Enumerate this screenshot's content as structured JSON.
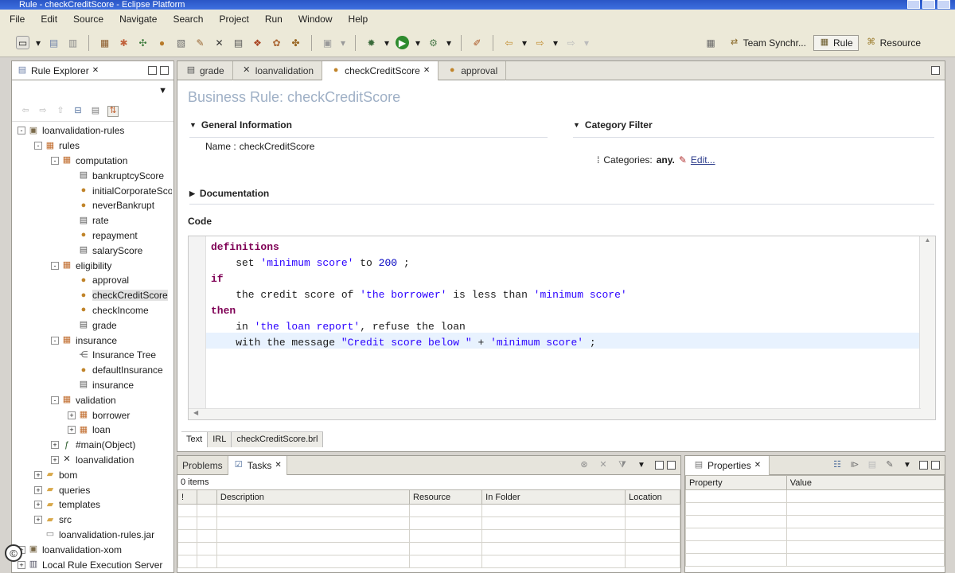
{
  "window": {
    "title": "Rule - checkCreditScore - Eclipse Platform"
  },
  "menu": [
    "File",
    "Edit",
    "Source",
    "Navigate",
    "Search",
    "Project",
    "Run",
    "Window",
    "Help"
  ],
  "toolbar": {
    "perspectives": [
      {
        "label": "Team Synchr...",
        "icon": "team-sync-icon",
        "active": false
      },
      {
        "label": "Rule",
        "icon": "rule-perspective-icon",
        "active": true
      },
      {
        "label": "Resource",
        "icon": "resource-perspective-icon",
        "active": false
      }
    ]
  },
  "explorer": {
    "title": "Rule Explorer",
    "tree": [
      {
        "label": "loanvalidation-rules",
        "depth": 0,
        "expander": "-",
        "icon": "project-icon"
      },
      {
        "label": "rules",
        "depth": 1,
        "expander": "-",
        "icon": "package-icon"
      },
      {
        "label": "computation",
        "depth": 2,
        "expander": "-",
        "icon": "package-icon"
      },
      {
        "label": "bankruptcyScore",
        "depth": 3,
        "expander": "",
        "icon": "decision-table-icon"
      },
      {
        "label": "initialCorporateScore",
        "depth": 3,
        "expander": "",
        "icon": "action-rule-icon"
      },
      {
        "label": "neverBankrupt",
        "depth": 3,
        "expander": "",
        "icon": "action-rule-icon"
      },
      {
        "label": "rate",
        "depth": 3,
        "expander": "",
        "icon": "decision-table-icon"
      },
      {
        "label": "repayment",
        "depth": 3,
        "expander": "",
        "icon": "action-rule-icon"
      },
      {
        "label": "salaryScore",
        "depth": 3,
        "expander": "",
        "icon": "decision-table-icon"
      },
      {
        "label": "eligibility",
        "depth": 2,
        "expander": "-",
        "icon": "package-icon"
      },
      {
        "label": "approval",
        "depth": 3,
        "expander": "",
        "icon": "action-rule-icon"
      },
      {
        "label": "checkCreditScore",
        "depth": 3,
        "expander": "",
        "icon": "action-rule-icon",
        "selected": true
      },
      {
        "label": "checkIncome",
        "depth": 3,
        "expander": "",
        "icon": "action-rule-icon"
      },
      {
        "label": "grade",
        "depth": 3,
        "expander": "",
        "icon": "decision-table-icon"
      },
      {
        "label": "insurance",
        "depth": 2,
        "expander": "-",
        "icon": "package-icon"
      },
      {
        "label": "Insurance Tree",
        "depth": 3,
        "expander": "",
        "icon": "decision-tree-icon"
      },
      {
        "label": "defaultInsurance",
        "depth": 3,
        "expander": "",
        "icon": "action-rule-icon"
      },
      {
        "label": "insurance",
        "depth": 3,
        "expander": "",
        "icon": "decision-table-icon"
      },
      {
        "label": "validation",
        "depth": 2,
        "expander": "-",
        "icon": "package-icon"
      },
      {
        "label": "borrower",
        "depth": 3,
        "expander": "+",
        "icon": "package-icon"
      },
      {
        "label": "loan",
        "depth": 3,
        "expander": "+",
        "icon": "package-icon"
      },
      {
        "label": "#main(Object)",
        "depth": 2,
        "expander": "+",
        "icon": "function-icon"
      },
      {
        "label": "loanvalidation",
        "depth": 2,
        "expander": "+",
        "icon": "ruleflow-icon"
      },
      {
        "label": "bom",
        "depth": 1,
        "expander": "+",
        "icon": "folder-icon"
      },
      {
        "label": "queries",
        "depth": 1,
        "expander": "+",
        "icon": "folder-icon"
      },
      {
        "label": "templates",
        "depth": 1,
        "expander": "+",
        "icon": "folder-icon"
      },
      {
        "label": "src",
        "depth": 1,
        "expander": "+",
        "icon": "folder-icon"
      },
      {
        "label": "loanvalidation-rules.jar",
        "depth": 1,
        "expander": "",
        "icon": "jar-icon"
      },
      {
        "label": "loanvalidation-xom",
        "depth": 0,
        "expander": "+",
        "icon": "project-icon"
      },
      {
        "label": "Local Rule Execution Server",
        "depth": 0,
        "expander": "+",
        "icon": "server-icon"
      }
    ]
  },
  "editor": {
    "tabs": [
      {
        "label": "grade",
        "icon": "decision-table-icon",
        "active": false
      },
      {
        "label": "loanvalidation",
        "icon": "ruleflow-icon",
        "active": false
      },
      {
        "label": "checkCreditScore",
        "icon": "action-rule-icon",
        "active": true
      },
      {
        "label": "approval",
        "icon": "action-rule-icon",
        "active": false
      }
    ],
    "heading": "Business Rule: checkCreditScore",
    "general_info": {
      "title": "General Information",
      "name_label": "Name :",
      "name_value": "checkCreditScore"
    },
    "category": {
      "title": "Category Filter",
      "label": "Categories:",
      "value": "any.",
      "edit": "Edit..."
    },
    "documentation": "Documentation",
    "code_label": "Code",
    "code": [
      [
        {
          "t": "definitions",
          "c": "kw"
        }
      ],
      [
        {
          "t": "    set ",
          "c": ""
        },
        {
          "t": "'minimum score'",
          "c": "str"
        },
        {
          "t": " to ",
          "c": ""
        },
        {
          "t": "200",
          "c": "num"
        },
        {
          "t": " ;",
          "c": ""
        }
      ],
      [
        {
          "t": "if",
          "c": "kw"
        }
      ],
      [
        {
          "t": "    the credit score of ",
          "c": ""
        },
        {
          "t": "'the borrower'",
          "c": "str"
        },
        {
          "t": " is less than ",
          "c": ""
        },
        {
          "t": "'minimum score'",
          "c": "str"
        }
      ],
      [
        {
          "t": "then",
          "c": "kw"
        }
      ],
      [
        {
          "t": "    in ",
          "c": ""
        },
        {
          "t": "'the loan report'",
          "c": "str"
        },
        {
          "t": ", refuse the loan",
          "c": ""
        }
      ],
      [
        {
          "t": "    with the message ",
          "c": ""
        },
        {
          "t": "\"Credit score below \"",
          "c": "str"
        },
        {
          "t": " + ",
          "c": ""
        },
        {
          "t": "'minimum score'",
          "c": "str"
        },
        {
          "t": " ;",
          "c": ""
        }
      ]
    ],
    "bottom_tabs": [
      "Text",
      "IRL",
      "checkCreditScore.brl"
    ]
  },
  "tasks": {
    "tabs": [
      {
        "label": "Problems",
        "active": false
      },
      {
        "label": "Tasks",
        "active": true
      }
    ],
    "count": "0 items",
    "columns": [
      "!",
      "",
      "Description",
      "Resource",
      "In Folder",
      "Location"
    ]
  },
  "properties": {
    "title": "Properties",
    "columns": [
      "Property",
      "Value"
    ]
  },
  "watermark": "©"
}
